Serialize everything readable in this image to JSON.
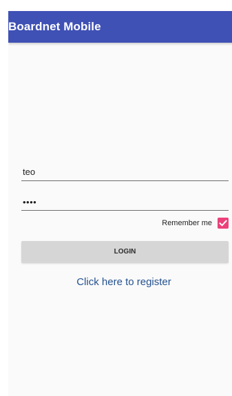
{
  "app": {
    "title": "Boardnet Mobile"
  },
  "login_form": {
    "username": {
      "value": "teo"
    },
    "password": {
      "masked_value": "••••"
    },
    "remember_me": {
      "label": "Remember me",
      "checked": true
    },
    "login_button": {
      "label": "LOGIN"
    },
    "register_link": {
      "label": "Click here to register"
    }
  },
  "colors": {
    "app_bar": "#3f51b5",
    "checkbox_accent": "#ec407a",
    "link": "#24518f"
  },
  "icons": {
    "checkbox": "checkmark-icon"
  }
}
